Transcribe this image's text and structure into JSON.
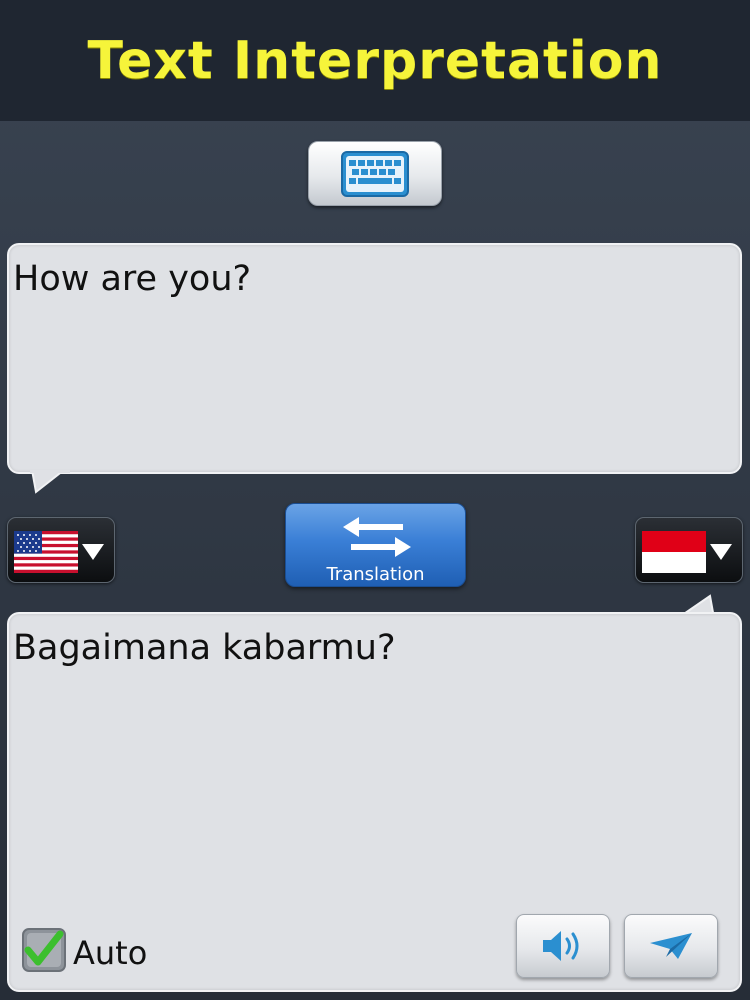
{
  "header": {
    "title": "Text Interpretation"
  },
  "input": {
    "text": "How are you?"
  },
  "output": {
    "text": "Bagaimana kabarmu?"
  },
  "languages": {
    "source_flag": "us-flag-icon",
    "target_flag": "indonesia-flag-icon"
  },
  "translate_button": {
    "label": "Translation"
  },
  "auto": {
    "label": "Auto",
    "checked": true
  },
  "colors": {
    "title": "#f6f43a",
    "header_bg": "#1f2631",
    "bubble_bg": "#dfe1e5",
    "translate_button": "#3a7fd6",
    "checkbox_green": "#3cbf2e"
  }
}
